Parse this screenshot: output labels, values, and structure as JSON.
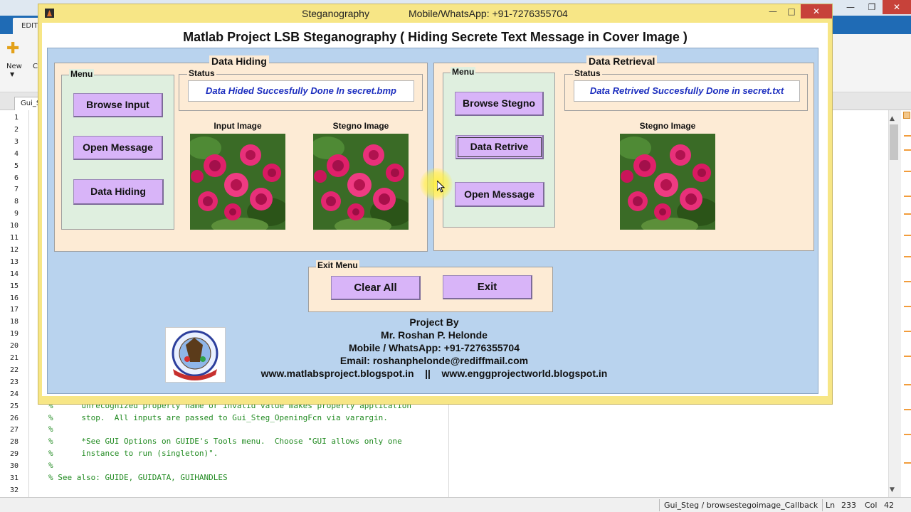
{
  "ide": {
    "tab_editor": "EDITO",
    "new_label": "New",
    "ribbon_partial": "C",
    "doc_tab": "Gui_S",
    "line_numbers": [
      "1",
      "2",
      "3",
      "4",
      "5",
      "6",
      "7",
      "8",
      "9",
      "10",
      "11",
      "12",
      "13",
      "14",
      "15",
      "16",
      "17",
      "18",
      "19",
      "20",
      "21",
      "22",
      "23",
      "24",
      "25",
      "26",
      "27",
      "28",
      "29",
      "30",
      "31",
      "32"
    ],
    "code_lines": [
      {
        "line": 25,
        "text": "%      unrecognized property name or invalid value makes property application"
      },
      {
        "line": 26,
        "text": "%      stop.  All inputs are passed to Gui_Steg_OpeningFcn via varargin."
      },
      {
        "line": 27,
        "text": "%"
      },
      {
        "line": 28,
        "text": "%      *See GUI Options on GUIDE's Tools menu.  Choose \"GUI allows only one"
      },
      {
        "line": 29,
        "text": "%      instance to run (singleton)\"."
      },
      {
        "line": 30,
        "text": "%"
      },
      {
        "line": 31,
        "text": "% See also: GUIDE, GUIDATA, GUIHANDLES"
      }
    ],
    "status": {
      "function": "Gui_Steg / browsestegoimage_Callback",
      "ln_label": "Ln",
      "ln": "233",
      "col_label": "Col",
      "col": "42"
    }
  },
  "figure": {
    "title_app": "Steganography",
    "title_contact": "Mobile/WhatsApp: +91-7276355704",
    "heading": "Matlab Project LSB Steganography ( Hiding Secrete Text Message in Cover Image )",
    "hiding": {
      "title": "Data Hiding",
      "menu_title": "Menu",
      "status_title": "Status",
      "status_text": "Data Hided Succesfully Done In secret.bmp",
      "buttons": {
        "browse": "Browse Input",
        "open": "Open Message",
        "hide": "Data Hiding"
      },
      "input_label": "Input Image",
      "stego_label": "Stegno Image"
    },
    "retrieval": {
      "title": "Data Retrieval",
      "menu_title": "Menu",
      "status_title": "Status",
      "status_text": "Data Retrived Succesfully Done in secret.txt",
      "buttons": {
        "browse": "Browse Stegno",
        "retrieve": "Data Retrive",
        "open": "Open Message"
      },
      "stego_label": "Stegno Image"
    },
    "exit_menu": {
      "title": "Exit Menu",
      "clear": "Clear All",
      "exit": "Exit"
    },
    "credits": {
      "line1": "Project By",
      "line2": "Mr. Roshan P. Helonde",
      "line3": "Mobile / WhatsApp: +91-7276355704",
      "line4": "Email: roshanphelonde@rediffmail.com",
      "site1": "www.matlabsproject.blogspot.in",
      "separator": "||",
      "site2": "www.enggprojectworld.blogspot.in"
    }
  }
}
